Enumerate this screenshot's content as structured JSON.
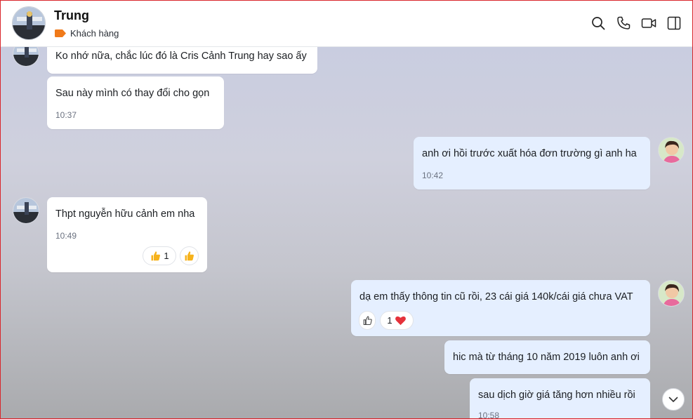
{
  "header": {
    "contact_name": "Trung",
    "tag_label": "Khách hàng",
    "tag_color": "#f07a1a",
    "icons": [
      "search-icon",
      "phone-icon",
      "video-icon",
      "sidebar-toggle-icon"
    ]
  },
  "messages": [
    {
      "side": "in",
      "text": "Ko nhớ nữa, chắc lúc đó là Cris Cảnh Trung hay sao ấy",
      "time": ""
    },
    {
      "side": "in",
      "text": "Sau này mình có thay đổi cho gọn",
      "time": "10:37"
    },
    {
      "side": "out",
      "text": "anh ơi hồi trước xuất hóa đơn trường gì anh ha",
      "time": "10:42"
    },
    {
      "side": "in",
      "text": "Thpt nguyễn hữu cảnh em nha",
      "time": "10:49",
      "reaction_count": "1"
    },
    {
      "side": "out",
      "text": "dạ em thấy thông tin cũ rồi, 23 cái giá 140k/cái giá chưa VAT",
      "time": "",
      "reaction_count": "1"
    },
    {
      "side": "out",
      "text": "hic mà từ tháng 10 năm 2019 luôn anh ơi",
      "time": ""
    },
    {
      "side": "out",
      "text": "sau dịch giờ giá tăng hơn nhiều rồi",
      "time": "10:58"
    }
  ],
  "colors": {
    "outgoing_bubble": "#e5efff",
    "incoming_bubble": "#ffffff",
    "heart": "#e5323b",
    "thumb": "#f6b21b"
  }
}
